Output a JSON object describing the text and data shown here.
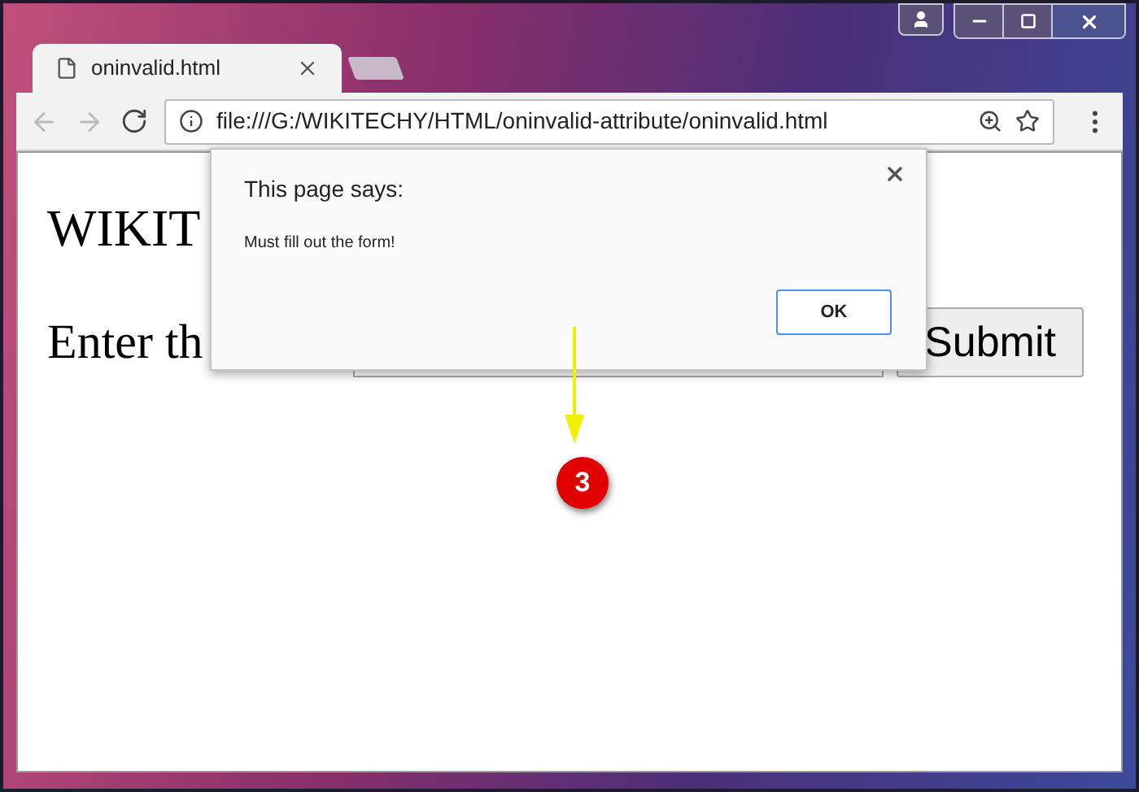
{
  "browser": {
    "tab": {
      "title": "oninvalid.html",
      "selected": true
    },
    "address": "file:///G:/WIKITECHY/HTML/oninvalid-attribute/oninvalid.html"
  },
  "page": {
    "heading": "WIKIT",
    "prompt": "Enter th",
    "submit": "Submit"
  },
  "dialog": {
    "title": "This page says:",
    "message": "Must fill out the form!",
    "ok": "OK"
  },
  "annotation": {
    "step": "3"
  }
}
